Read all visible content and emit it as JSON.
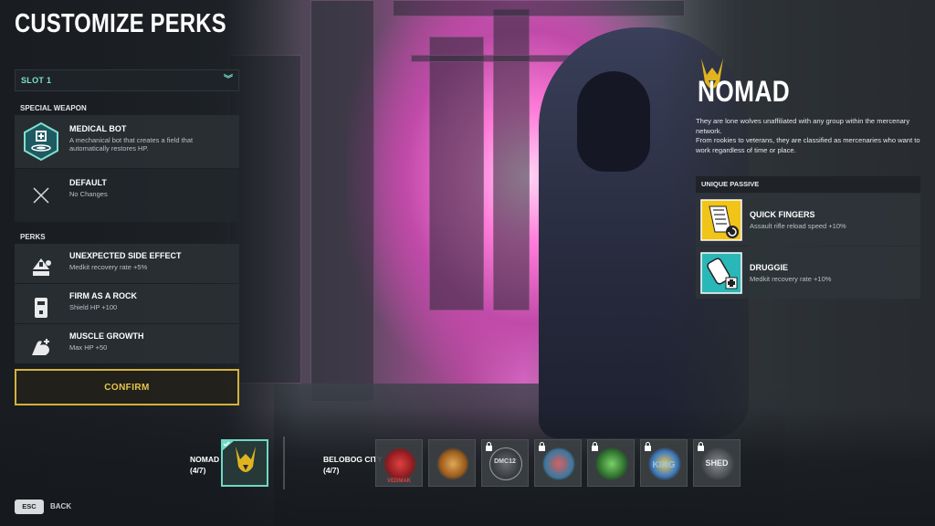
{
  "page": {
    "title": "CUSTOMIZE PERKS"
  },
  "slot_selector": {
    "label": "SLOT 1",
    "icon": "double-chevron-down-icon"
  },
  "special_weapon": {
    "section_label": "SPECIAL WEAPON",
    "items": [
      {
        "name": "MEDICAL BOT",
        "desc": "A mechanical bot that creates a field that automatically restores HP.",
        "icon": "medical-bot-icon",
        "selected": true
      },
      {
        "name": "DEFAULT",
        "desc": "No Changes",
        "icon": "close-x-icon",
        "selected": false
      }
    ]
  },
  "perks": {
    "section_label": "PERKS",
    "items": [
      {
        "name": "UNEXPECTED SIDE EFFECT",
        "desc": "Medkit recovery rate +5%",
        "icon": "medkit-effect-icon"
      },
      {
        "name": "FIRM AS A ROCK",
        "desc": "Shield HP +100",
        "icon": "shield-icon"
      },
      {
        "name": "MUSCLE GROWTH",
        "desc": "Max HP +50",
        "icon": "flexed-arm-icon"
      }
    ]
  },
  "confirm": {
    "label": "CONFIRM"
  },
  "faction": {
    "name": "NOMAD",
    "description": "They are lone wolves unaffiliated with any group within the mercenary network.\nFrom rookies to veterans, they are classified as mercenaries who want to work regardless of time or place.",
    "emblem_icon": "nomad-jackal-icon"
  },
  "unique_passive": {
    "header": "UNIQUE PASSIVE",
    "items": [
      {
        "name": "QUICK FINGERS",
        "desc": "Assault rifle reload speed +10%",
        "icon": "quick-fingers-icon",
        "bg": "#f0c418"
      },
      {
        "name": "DRUGGIE",
        "desc": "Medkit recovery rate +10%",
        "icon": "druggie-pill-icon",
        "bg": "#2ab7b8"
      }
    ]
  },
  "faction_selector": {
    "current_group": {
      "name": "NOMAD",
      "count": "(4/7)"
    },
    "other_group": {
      "name": "BELOBOG CITY",
      "count": "(4/7)"
    },
    "emblems": [
      {
        "name": "Nomad",
        "icon": "nomad-emblem-icon",
        "selected": true,
        "locked": false,
        "color": "#e0b420"
      },
      {
        "name": "Vedmak",
        "icon": "vedmak-emblem-icon",
        "selected": false,
        "locked": false,
        "color": "#b81e24",
        "label": "VEDMAK"
      },
      {
        "name": "Serpent",
        "icon": "snake-emblem-icon",
        "selected": false,
        "locked": false,
        "color": "#c8883a"
      },
      {
        "name": "DMC12",
        "icon": "dmc12-emblem-icon",
        "selected": false,
        "locked": true,
        "color": "#8a8e92",
        "label": "DMC12"
      },
      {
        "name": "Red badge",
        "icon": "red-badge-emblem-icon",
        "selected": false,
        "locked": true,
        "color": "#c04040"
      },
      {
        "name": "Green skull",
        "icon": "green-skull-emblem-icon",
        "selected": false,
        "locked": true,
        "color": "#3aa04a"
      },
      {
        "name": "King",
        "icon": "king-emblem-icon",
        "selected": false,
        "locked": true,
        "color": "#3a78c0",
        "label": "KING"
      },
      {
        "name": "Shed",
        "icon": "shed-emblem-icon",
        "selected": false,
        "locked": true,
        "color": "#9a9ea2",
        "label": "SHED"
      }
    ]
  },
  "footer": {
    "key": "ESC",
    "action": "BACK"
  },
  "colors": {
    "accent_teal": "#7ee0cf",
    "confirm_gold": "#d4b23c",
    "panel_dark": "#2a3034"
  }
}
